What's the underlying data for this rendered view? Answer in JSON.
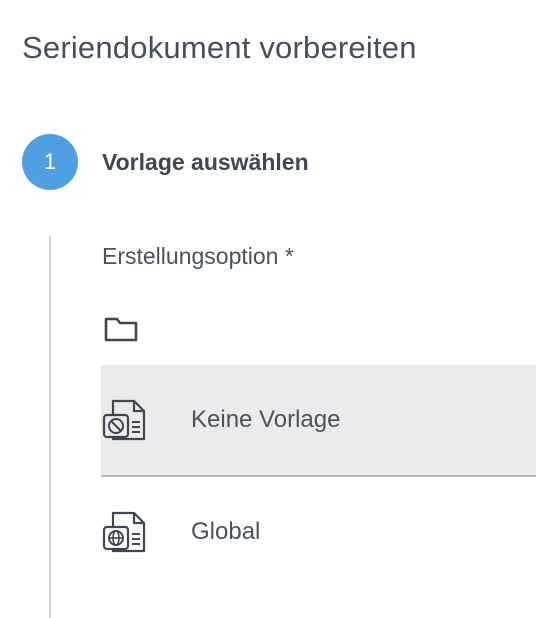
{
  "page": {
    "title": "Seriendokument vorbereiten"
  },
  "step": {
    "number": "1",
    "title": "Vorlage auswählen"
  },
  "creation_option": {
    "label": "Erstellungsoption *",
    "folder_icon": "folder-icon",
    "options": [
      {
        "label": "Keine Vorlage",
        "icon": "no-template-document-icon",
        "selected": true
      },
      {
        "label": "Global",
        "icon": "global-template-document-icon",
        "selected": false
      }
    ]
  },
  "colors": {
    "accent": "#4f9fe3",
    "text": "#4a525d",
    "selected_bg": "#ebebed"
  }
}
